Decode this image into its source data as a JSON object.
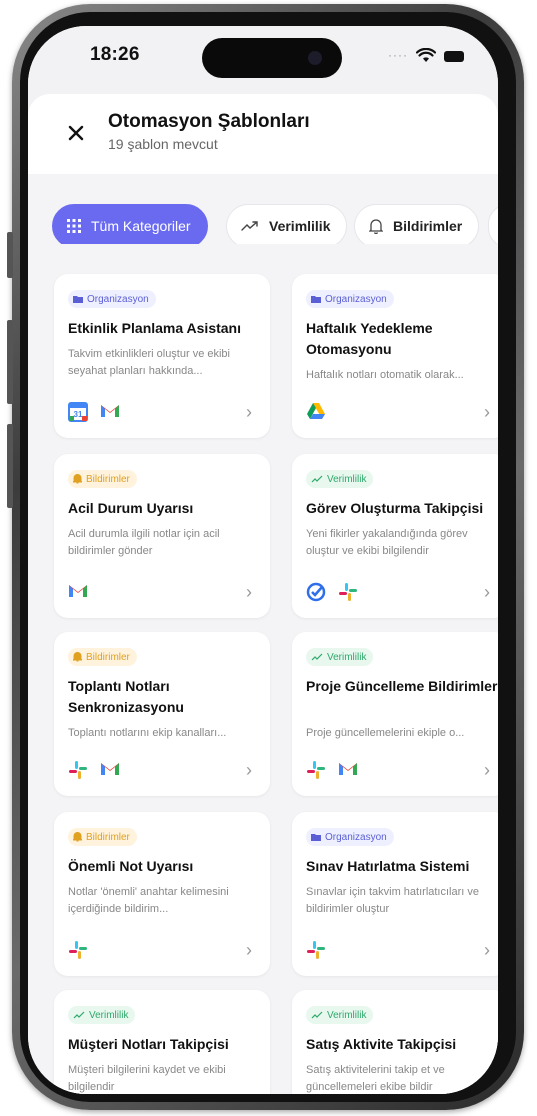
{
  "status_bar": {
    "time": "18:26"
  },
  "header": {
    "title": "Otomasyon Şablonları",
    "subtitle": "19 şablon mevcut"
  },
  "chips": [
    {
      "label": "Tüm Kategoriler",
      "icon": "grid-icon",
      "active": true
    },
    {
      "label": "Verimlilik",
      "icon": "trend-up-icon",
      "active": false
    },
    {
      "label": "Bildirimler",
      "icon": "bell-icon",
      "active": false
    }
  ],
  "colors": {
    "accent": "#6a6af0",
    "organizasyon": "#5b5fd6",
    "bildirimler": "#e0a020",
    "verimlilik": "#2fa86a"
  },
  "cards": [
    {
      "category": "Organizasyon",
      "title": "Etkinlik Planlama Asistanı",
      "desc": "Takvim etkinlikleri oluştur ve ekibi seyahat planları hakkında...",
      "apps": [
        "google-calendar-icon",
        "gmail-icon"
      ]
    },
    {
      "category": "Organizasyon",
      "title": "Haftalık Yedekleme Otomasyonu",
      "desc": "Haftalık notları otomatik olarak...",
      "apps": [
        "google-drive-icon"
      ]
    },
    {
      "category": "Bildirimler",
      "title": "Acil Durum Uyarısı",
      "desc": "Acil durumla ilgili notlar için acil bildirimler gönder",
      "apps": [
        "gmail-icon"
      ]
    },
    {
      "category": "Verimlilik",
      "title": "Görev Oluşturma Takipçisi",
      "desc": "Yeni fikirler yakalandığında görev oluştur ve ekibi bilgilendir",
      "apps": [
        "task-check-icon",
        "slack-icon"
      ]
    },
    {
      "category": "Bildirimler",
      "title": "Toplantı Notları Senkronizasyonu",
      "desc": "Toplantı notlarını ekip kanalları...",
      "apps": [
        "slack-icon",
        "gmail-icon"
      ]
    },
    {
      "category": "Verimlilik",
      "title": "Proje Güncelleme Bildirimleri",
      "desc": "Proje güncellemelerini ekiple o...",
      "apps": [
        "slack-icon",
        "gmail-icon"
      ]
    },
    {
      "category": "Bildirimler",
      "title": "Önemli Not Uyarısı",
      "desc": "Notlar 'önemli' anahtar kelimesini içerdiğinde bildirim...",
      "apps": [
        "slack-icon"
      ]
    },
    {
      "category": "Organizasyon",
      "title": "Sınav Hatırlatma Sistemi",
      "desc": "Sınavlar için takvim hatırlatıcıları ve bildirimler oluştur",
      "apps": [
        "slack-icon"
      ]
    },
    {
      "category": "Verimlilik",
      "title": "Müşteri Notları Takipçisi",
      "desc": "Müşteri bilgilerini kaydet ve ekibi bilgilendir",
      "apps": []
    },
    {
      "category": "Verimlilik",
      "title": "Satış Aktivite Takipçisi",
      "desc": "Satış aktivitelerini takip et ve güncellemeleri ekibe bildir",
      "apps": []
    }
  ]
}
